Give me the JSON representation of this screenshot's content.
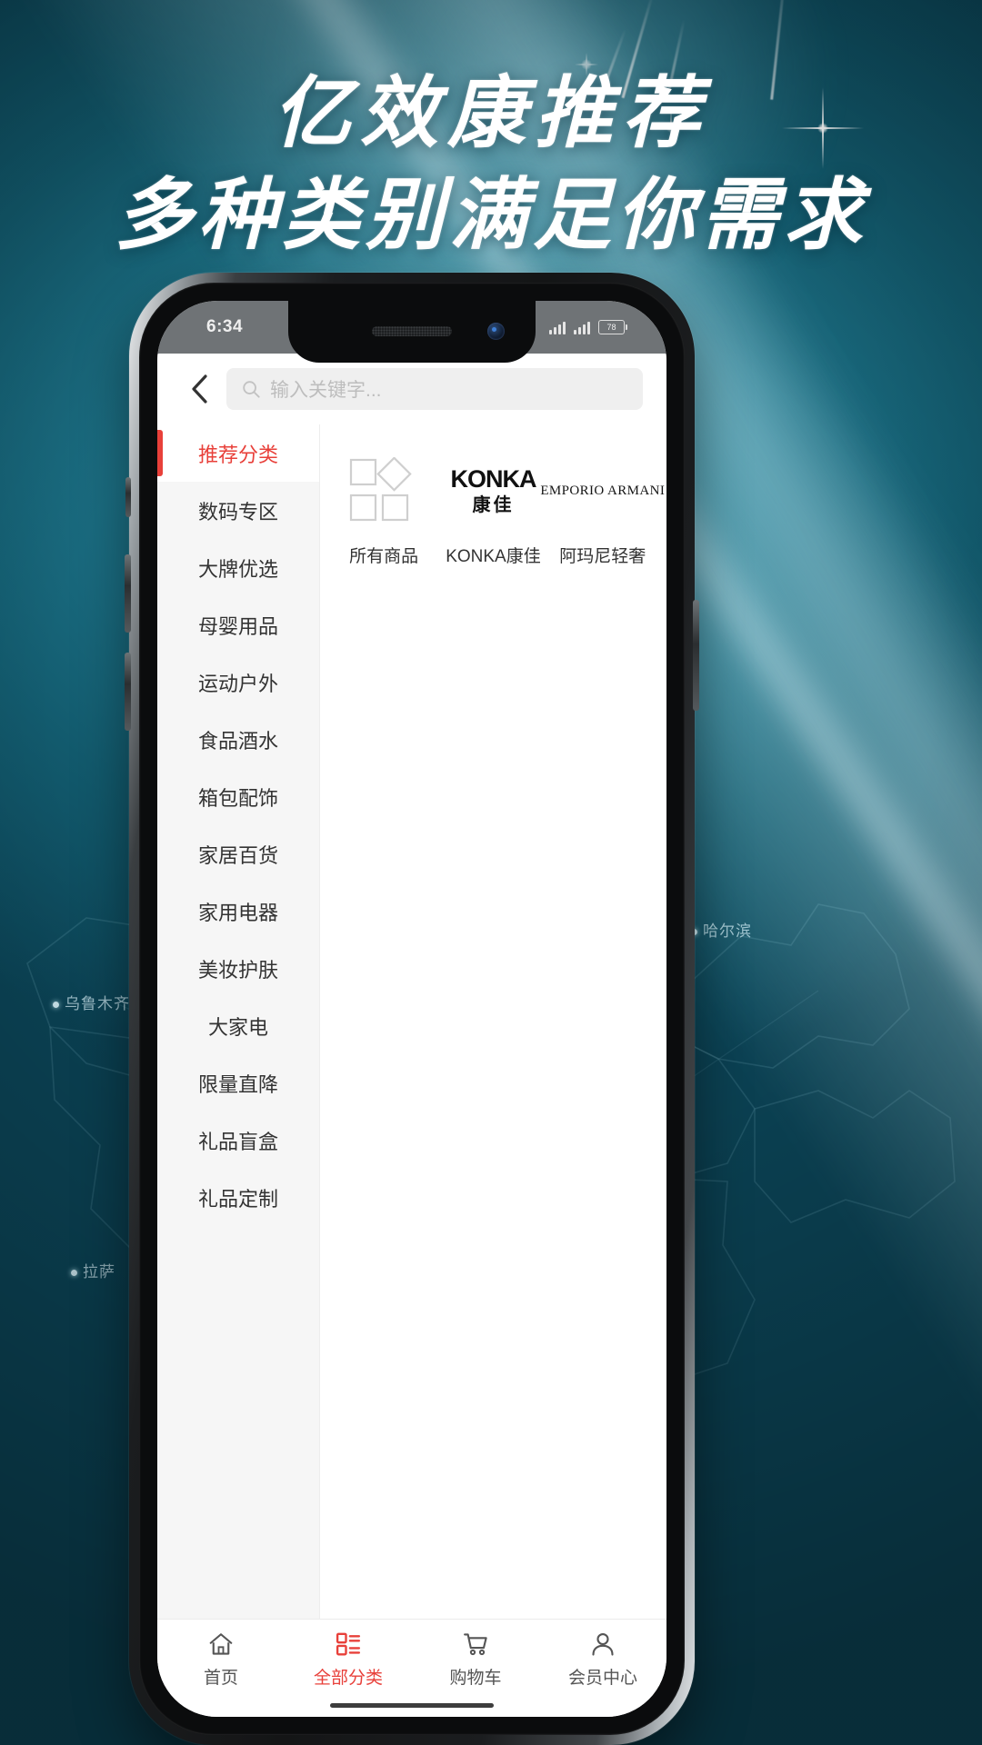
{
  "poster": {
    "headline_line1": "亿效康推荐",
    "headline_line2": "多种类别满足你需求",
    "background_color": "#0d5f72",
    "accent_color": "#e8403a"
  },
  "map_labels": [
    {
      "name": "哈尔滨"
    },
    {
      "name": "乌鲁木齐"
    },
    {
      "name": "拉萨"
    }
  ],
  "phone": {
    "status_bar": {
      "time": "6:34",
      "battery_level": "78",
      "signal_icon": "signal-bars-icon",
      "wifi_icon": "wifi-icon",
      "battery_icon": "battery-icon"
    }
  },
  "app": {
    "back_icon": "chevron-left-icon",
    "search": {
      "icon": "search-icon",
      "placeholder": "输入关键字...",
      "value": ""
    },
    "sidebar": {
      "items": [
        {
          "label": "推荐分类",
          "active": true
        },
        {
          "label": "数码专区",
          "active": false
        },
        {
          "label": "大牌优选",
          "active": false
        },
        {
          "label": "母婴用品",
          "active": false
        },
        {
          "label": "运动户外",
          "active": false
        },
        {
          "label": "食品酒水",
          "active": false
        },
        {
          "label": "箱包配饰",
          "active": false
        },
        {
          "label": "家居百货",
          "active": false
        },
        {
          "label": "家用电器",
          "active": false
        },
        {
          "label": "美妆护肤",
          "active": false
        },
        {
          "label": "大家电",
          "active": false
        },
        {
          "label": "限量直降",
          "active": false
        },
        {
          "label": "礼品盲盒",
          "active": false
        },
        {
          "label": "礼品定制",
          "active": false
        }
      ]
    },
    "brands": [
      {
        "name": "所有商品",
        "logo_type": "shapes",
        "logo_icon": "square-diamond-icon"
      },
      {
        "name": "KONKA康佳",
        "logo_type": "konka",
        "logo_en": "KONKA",
        "logo_cn": "康佳"
      },
      {
        "name": "阿玛尼轻奢",
        "logo_type": "armani",
        "logo_en": "EMPORIO ARMANI"
      }
    ],
    "tabbar": [
      {
        "label": "首页",
        "icon": "home-icon",
        "active": false
      },
      {
        "label": "全部分类",
        "icon": "grid-list-icon",
        "active": true
      },
      {
        "label": "购物车",
        "icon": "cart-icon",
        "active": false
      },
      {
        "label": "会员中心",
        "icon": "person-icon",
        "active": false
      }
    ]
  }
}
